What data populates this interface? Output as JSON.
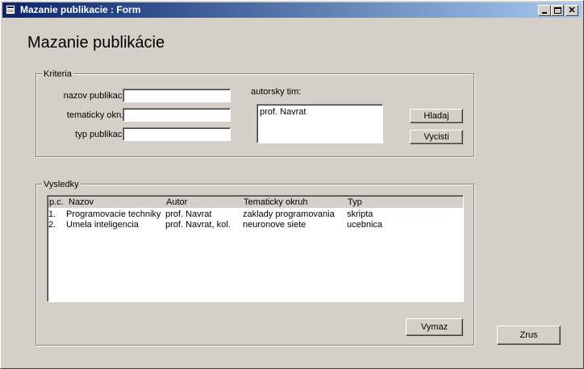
{
  "window": {
    "title": "Mazanie publikacie : Form"
  },
  "heading": "Mazanie publikácie",
  "criteria": {
    "legend": "Kriteria",
    "fields": {
      "nazov_label": "nazov publikacie:",
      "nazov_value": "",
      "okruh_label": "tematicky okruh:",
      "okruh_value": "",
      "typ_label": "typ publikacie:",
      "typ_value": ""
    },
    "team_label": "autorsky tim:",
    "team_items": [
      "prof. Navrat"
    ],
    "search_button": "Hladaj",
    "clear_button": "Vycisti"
  },
  "results": {
    "legend": "Vysledky",
    "columns": [
      "p.c.",
      "Nazov",
      "Autor",
      "Tematicky okruh",
      "Typ"
    ],
    "rows": [
      [
        "1.",
        "Programovacie techniky",
        "prof. Navrat",
        "zaklady programovania",
        "skripta"
      ],
      [
        "2.",
        "Umela inteligencia",
        "prof. Navrat, kol.",
        "neuronove siete",
        "ucebnica"
      ]
    ],
    "delete_button": "Vymaz"
  },
  "close_button": "Zrus",
  "icons": {
    "app": "form-icon",
    "minimize": "minimize-icon",
    "maximize": "maximize-icon",
    "close": "close-icon"
  }
}
